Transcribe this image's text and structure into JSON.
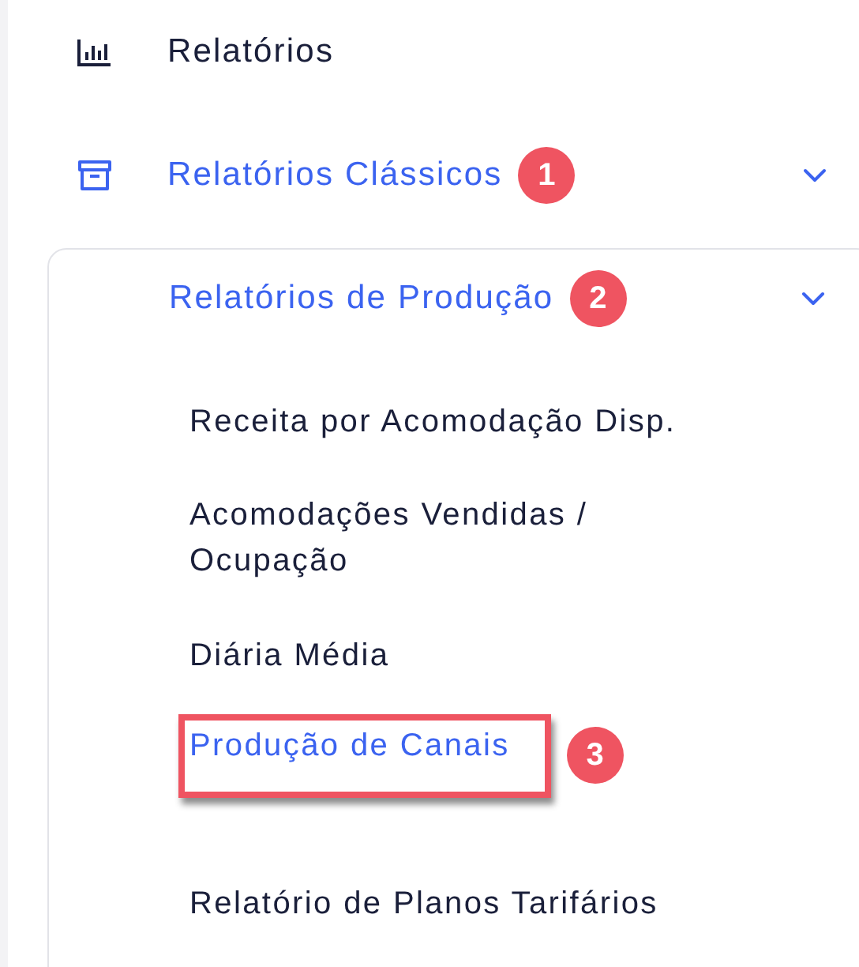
{
  "menu": [
    {
      "label": "Relatórios",
      "kind": "link",
      "selected": false
    },
    {
      "label": "Relatórios Clássicos",
      "kind": "group",
      "selected": true,
      "expanded": true,
      "badge": "1",
      "children": [
        {
          "label": "Relatórios de Produção",
          "selected": true,
          "expanded": true,
          "badge": "2",
          "children": [
            {
              "label": "Receita por Acomodação Disp.",
              "selected": false,
              "highlighted": false
            },
            {
              "label": "Acomodações Vendidas / Ocupação",
              "selected": false,
              "highlighted": false
            },
            {
              "label": "Diária Média",
              "selected": false,
              "highlighted": false
            },
            {
              "label": "Produção de Canais",
              "selected": true,
              "highlighted": true,
              "badge": "3"
            },
            {
              "label": "Relatório de Planos Tarifários",
              "selected": false,
              "highlighted": false
            }
          ]
        }
      ]
    }
  ]
}
